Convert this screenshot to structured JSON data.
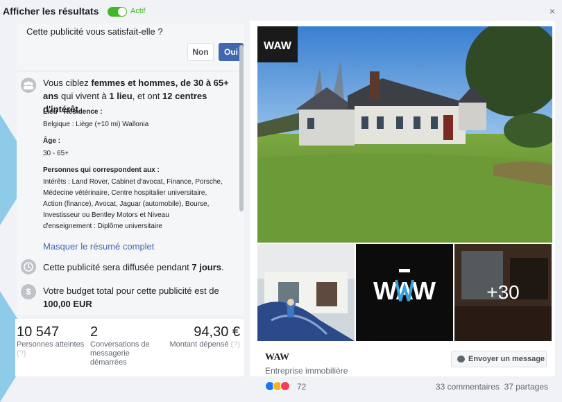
{
  "header": {
    "title": "Afficher les résultats",
    "toggle_label": "Actif",
    "close_glyph": "×"
  },
  "feedback": {
    "question": "Cette publicité vous satisfait-elle ?",
    "no_label": "Non",
    "yes_label": "Oui"
  },
  "targeting": {
    "summary_parts": [
      "Vous ciblez ",
      "femmes et hommes, de 30 à 65+ ans",
      " qui vivent à ",
      "1 lieu",
      ", et ont ",
      "12 centres d'intérêt",
      "."
    ],
    "location_title": "Lieu - Résidence :",
    "location_value": "Belgique : Liège (+10 mi) Wallonia",
    "age_title": "Âge :",
    "age_value": "30 - 65+",
    "people_title": "Personnes qui correspondent aux :",
    "interests_lines": [
      "Intérêts : Land Rover, Cabinet d'avocat, Finance, Porsche,",
      "Médecine vétérinaire, Centre hospitalier universitaire,",
      "Action (finance), Avocat, Jaguar (automobile), Bourse,",
      "Investisseur ou Bentley Motors et Niveau",
      "d'enseignement : Diplôme universitaire"
    ],
    "hide_link": "Masquer le résumé complet"
  },
  "duration": {
    "text": "Cette publicité sera diffusée pendant ",
    "bold": "7 jours",
    "end": "."
  },
  "budget": {
    "line1": "Votre budget total pour cette publicité est de",
    "amount": "100,00 EUR"
  },
  "stats": {
    "reach_value": "10 547",
    "reach_label": "Personnes atteintes",
    "reach_help": "(?)",
    "conv_value": "2",
    "conv_label_lines": [
      "Conversations de",
      "messagerie",
      "démarrées"
    ],
    "spent_value": "94,30 €",
    "spent_label": "Montant dépensé",
    "spent_help": "(?)"
  },
  "ad": {
    "logo_text": "WAW",
    "page_name": "WAW",
    "category": "Entreprise immobilière",
    "message_button": "Envoyer un message",
    "more_photos": "+30",
    "reaction_count": "72",
    "comments": "33 commentaires",
    "shares": "37 partages",
    "brand_color": "#3b9fd8"
  },
  "colors": {
    "accent": "#4267b2",
    "active_green": "#42b72a",
    "arrow_blue": "#8dcbe9"
  }
}
